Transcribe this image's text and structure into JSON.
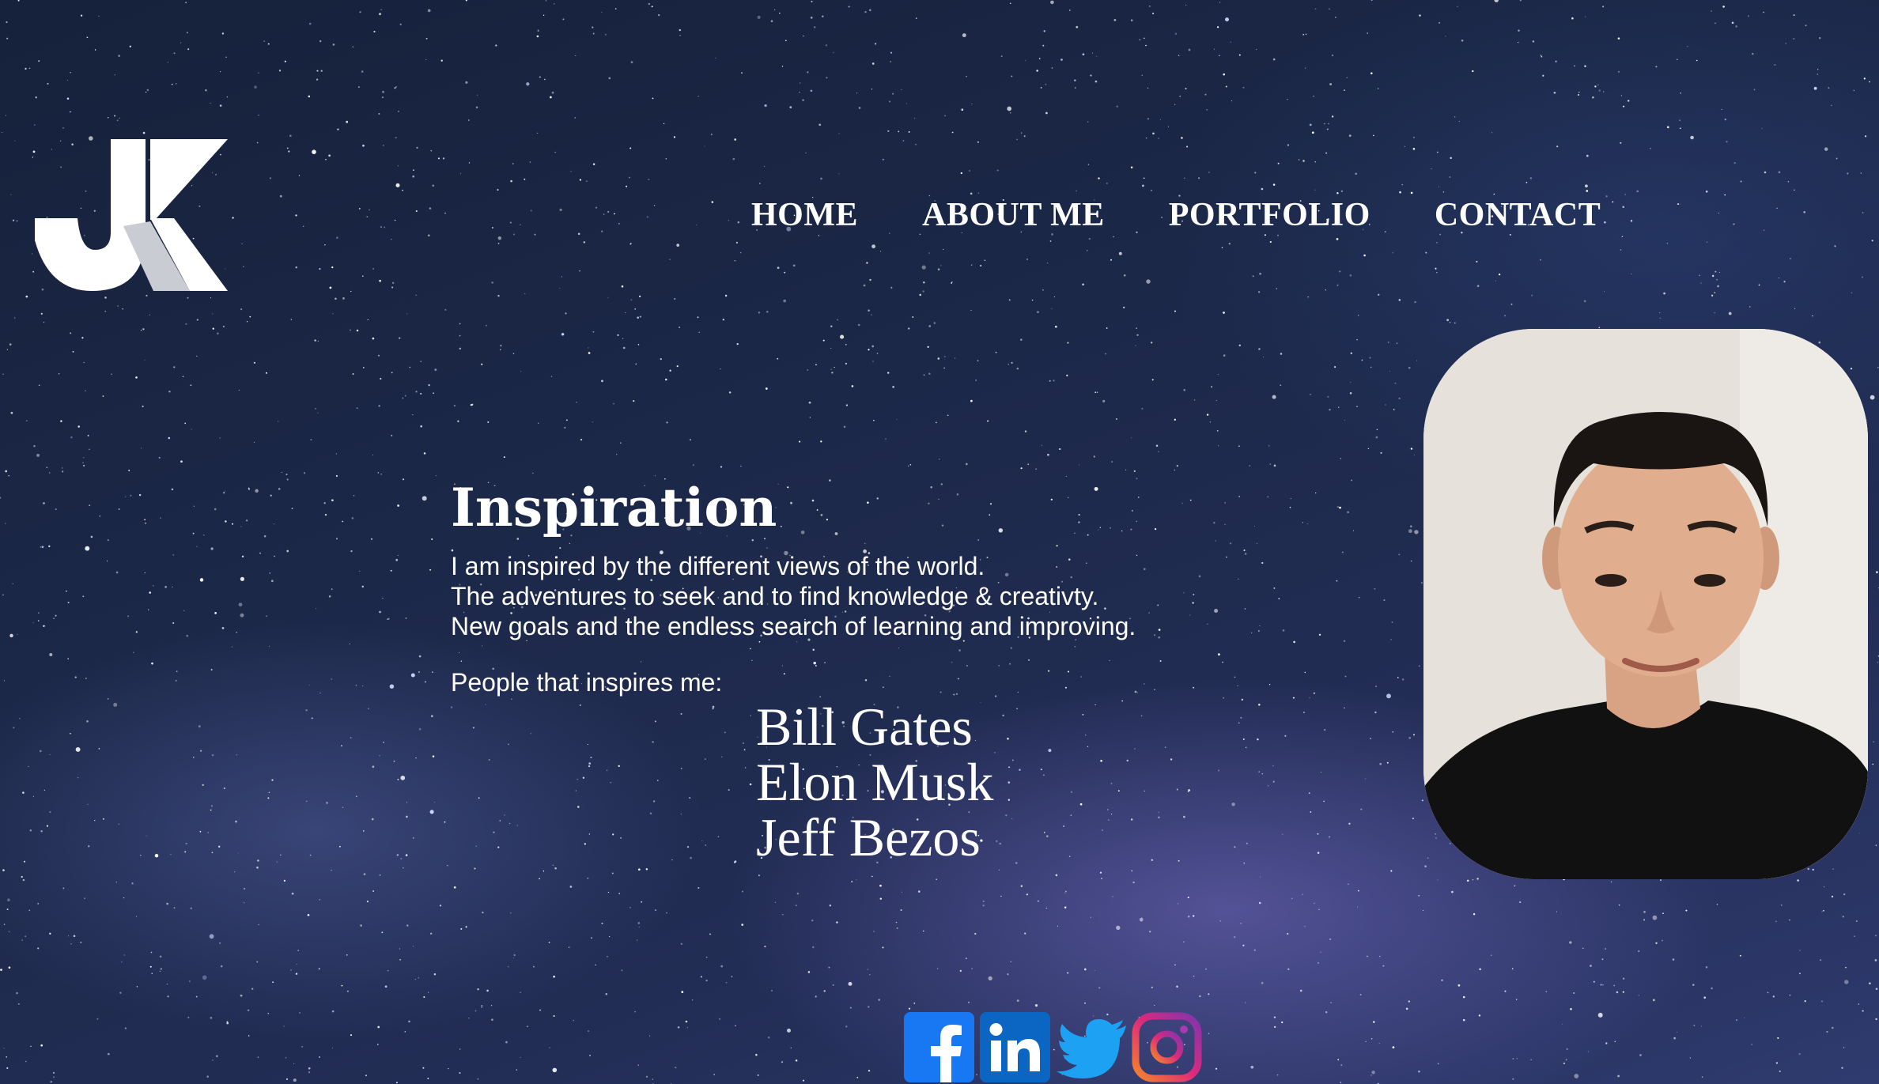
{
  "logo": {
    "text": "JK"
  },
  "nav": {
    "items": [
      {
        "label": "HOME"
      },
      {
        "label": "ABOUT ME"
      },
      {
        "label": "PORTFOLIO"
      },
      {
        "label": "CONTACT"
      }
    ]
  },
  "main": {
    "title": "Inspiration",
    "lines": [
      "I am inspired by the different views of the world.",
      "The adventures to seek and to find knowledge & creativty.",
      "New goals and the endless search of learning and improving."
    ],
    "people_label": "People that inspires me:",
    "people": [
      "Bill Gates",
      "Elon Musk",
      "Jeff Bezos"
    ]
  },
  "social": {
    "links": [
      {
        "icon": "facebook-icon",
        "color": "#1877f2"
      },
      {
        "icon": "linkedin-icon",
        "color": "#0a66c2"
      },
      {
        "icon": "twitter-icon",
        "color": "#1da1f2"
      },
      {
        "icon": "instagram-icon",
        "color": "#c13584"
      }
    ]
  },
  "colors": {
    "text": "#ffffff",
    "background": "#1b2746"
  }
}
